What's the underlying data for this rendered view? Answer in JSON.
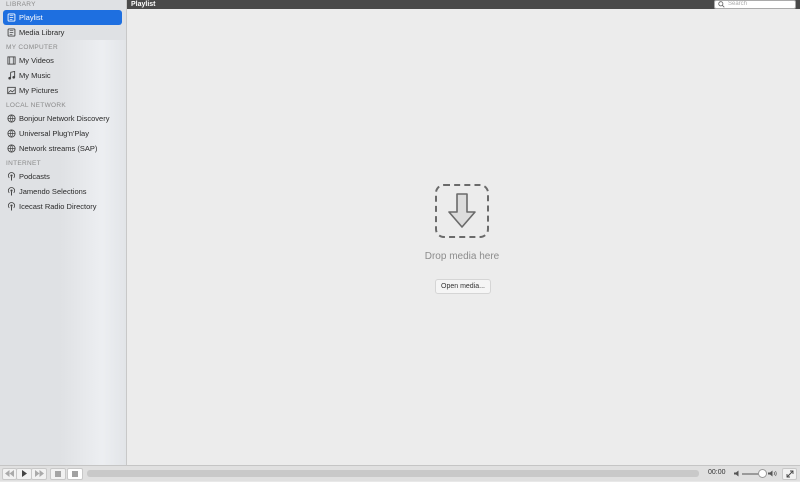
{
  "sidebar": {
    "sections": [
      {
        "title": "LIBRARY",
        "items": [
          {
            "label": "Playlist",
            "icon": "playlist-icon",
            "active": true
          },
          {
            "label": "Media Library",
            "icon": "media-library-icon",
            "active": false
          }
        ]
      },
      {
        "title": "MY COMPUTER",
        "items": [
          {
            "label": "My Videos",
            "icon": "film-icon",
            "active": false
          },
          {
            "label": "My Music",
            "icon": "music-note-icon",
            "active": false
          },
          {
            "label": "My Pictures",
            "icon": "picture-icon",
            "active": false
          }
        ]
      },
      {
        "title": "LOCAL NETWORK",
        "items": [
          {
            "label": "Bonjour Network Discovery",
            "icon": "network-icon",
            "active": false
          },
          {
            "label": "Universal Plug'n'Play",
            "icon": "network-icon",
            "active": false
          },
          {
            "label": "Network streams (SAP)",
            "icon": "network-icon",
            "active": false
          }
        ]
      },
      {
        "title": "INTERNET",
        "items": [
          {
            "label": "Podcasts",
            "icon": "podcast-icon",
            "active": false
          },
          {
            "label": "Jamendo Selections",
            "icon": "podcast-icon",
            "active": false
          },
          {
            "label": "Icecast Radio Directory",
            "icon": "podcast-icon",
            "active": false
          }
        ]
      }
    ]
  },
  "header": {
    "title": "Playlist",
    "search_placeholder": "Search"
  },
  "main": {
    "drop_text": "Drop media here",
    "open_button": "Open media..."
  },
  "controls": {
    "time": "00:00",
    "volume_fraction": 0.85
  },
  "colors": {
    "accent": "#1e6fe0",
    "titlebar": "#4a4a4a"
  }
}
